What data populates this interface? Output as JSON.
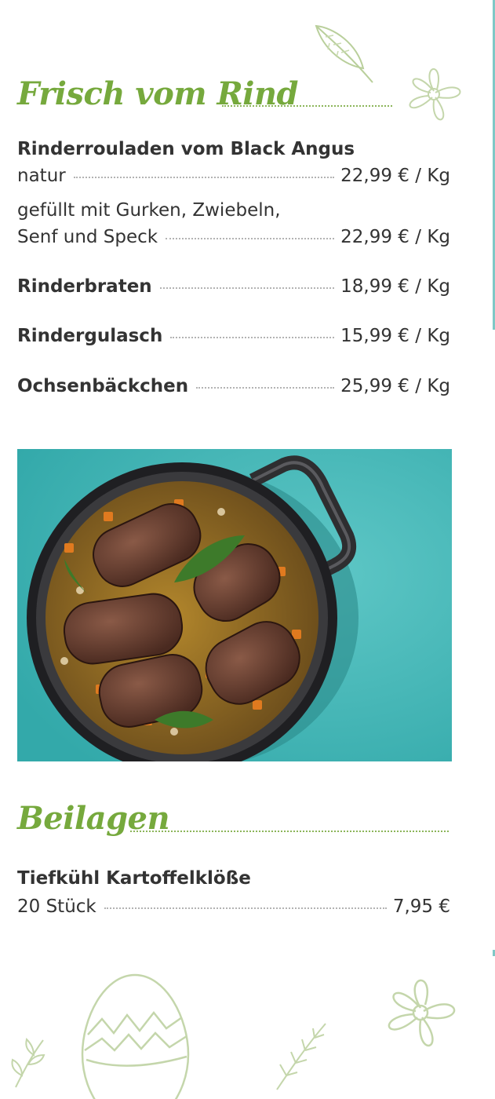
{
  "colors": {
    "accent_green": "#76a93d",
    "text": "#333333",
    "photo_bg": "#3fb2b2"
  },
  "section_rind": {
    "title": "Frisch vom Rind",
    "item_rouladen": {
      "name": "Rinderrouladen vom Black Angus",
      "v1_label": "natur",
      "v1_price": "22,99 € / Kg",
      "v2_line1": "gefüllt mit Gurken, Zwiebeln,",
      "v2_line2": "Senf und Speck",
      "v2_price": "22,99 € / Kg"
    },
    "items": [
      {
        "name": "Rinderbraten",
        "price": "18,99 € / Kg"
      },
      {
        "name": "Rindergulasch",
        "price": "15,99 € / Kg"
      },
      {
        "name": "Ochsenbäckchen",
        "price": "25,99 € / Kg"
      }
    ]
  },
  "photo": {
    "icon": "beef-roulades-in-pot-photo"
  },
  "section_beilagen": {
    "title": "Beilagen",
    "item": {
      "name": "Tiefkühl Kartoffelklöße",
      "detail": "20 Stück",
      "price": "7,95 €"
    }
  },
  "decorations": [
    "leaf-icon",
    "flower-icon",
    "easter-egg-icon",
    "herb-sprig-icon"
  ]
}
